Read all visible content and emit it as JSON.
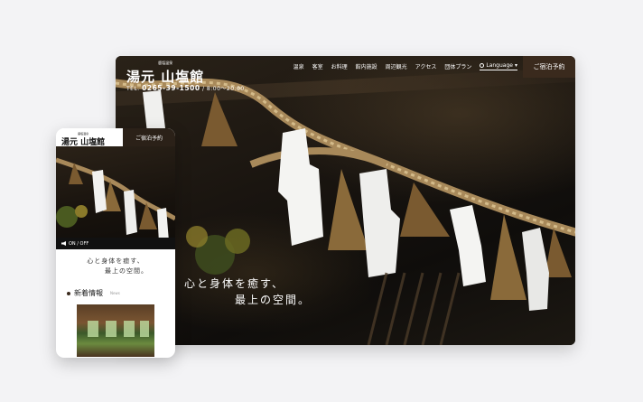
{
  "desktop": {
    "logo": {
      "small": "鹿塩温泉",
      "main": "湯元 山塩館"
    },
    "tel": {
      "prefix": "TEL.",
      "number": "0265-39-1500",
      "hours": "/ 8:00〜20:00"
    },
    "nav": [
      "温泉",
      "客室",
      "お料理",
      "館内施設",
      "周辺観光",
      "アクセス",
      "団体プラン"
    ],
    "language_label": "Language",
    "booking_button": "ご宿泊予約",
    "catch_line1": "心と身体を癒す、",
    "catch_line2": "最上の空間。"
  },
  "phone": {
    "logo": {
      "small": "鹿塩温泉",
      "main": "湯元 山塩館"
    },
    "booking_button": "ご宿泊予約",
    "sound_label": "ON / OFF",
    "catch_line1": "心と身体を癒す、",
    "catch_line2": "最上の空間。",
    "news_title": "新着情報",
    "news_en": "News"
  },
  "colors": {
    "booking_bg": "#3a2a1d",
    "page_bg": "#f3f3f5"
  }
}
